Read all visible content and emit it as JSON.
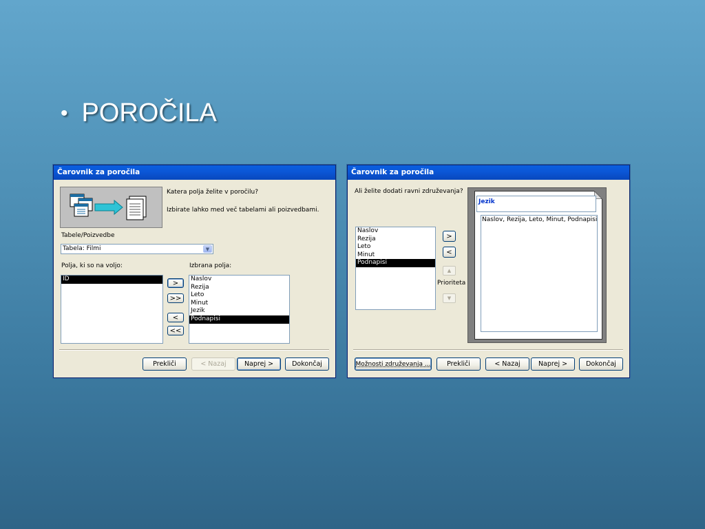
{
  "slide": {
    "bullet": "•",
    "title": "POROČILA"
  },
  "dialog1": {
    "title": "Čarovnik za poročila",
    "question": "Katera polja želite v poročilu?",
    "hint": "Izbirate lahko med več tabelami ali poizvedbami.",
    "tables_label": "Tabele/Poizvedbe",
    "tables_value": "Tabela: Filmi",
    "available_label": "Polja, ki so na voljo:",
    "selected_label": "Izbrana polja:",
    "available_fields": [
      "ID"
    ],
    "selected_fields": [
      "Naslov",
      "Rezija",
      "Leto",
      "Minut",
      "Jezik",
      "Podnapisi"
    ],
    "btn_add": ">",
    "btn_add_all": ">>",
    "btn_remove": "<",
    "btn_remove_all": "<<",
    "btn_cancel": "Prekliči",
    "btn_back": "< Nazaj",
    "btn_next": "Naprej >",
    "btn_finish": "Dokončaj"
  },
  "dialog2": {
    "title": "Čarovnik za poročila",
    "question": "Ali želite dodati ravni združevanja?",
    "fields": [
      "Naslov",
      "Rezija",
      "Leto",
      "Minut",
      "Podnapisi"
    ],
    "btn_add": ">",
    "btn_remove": "<",
    "priority_label": "Prioriteta",
    "preview_group": "Jezik",
    "preview_fields": "Naslov, Rezija, Leto, Minut, Podnapisi",
    "btn_grouping": "Možnosti združevanja ...",
    "btn_cancel": "Prekliči",
    "btn_back": "< Nazaj",
    "btn_next": "Naprej >",
    "btn_finish": "Dokončaj"
  },
  "colors": {
    "titlebar": "#0b56d6",
    "dialog_bg": "#ece9d8",
    "selection": "#000000"
  }
}
